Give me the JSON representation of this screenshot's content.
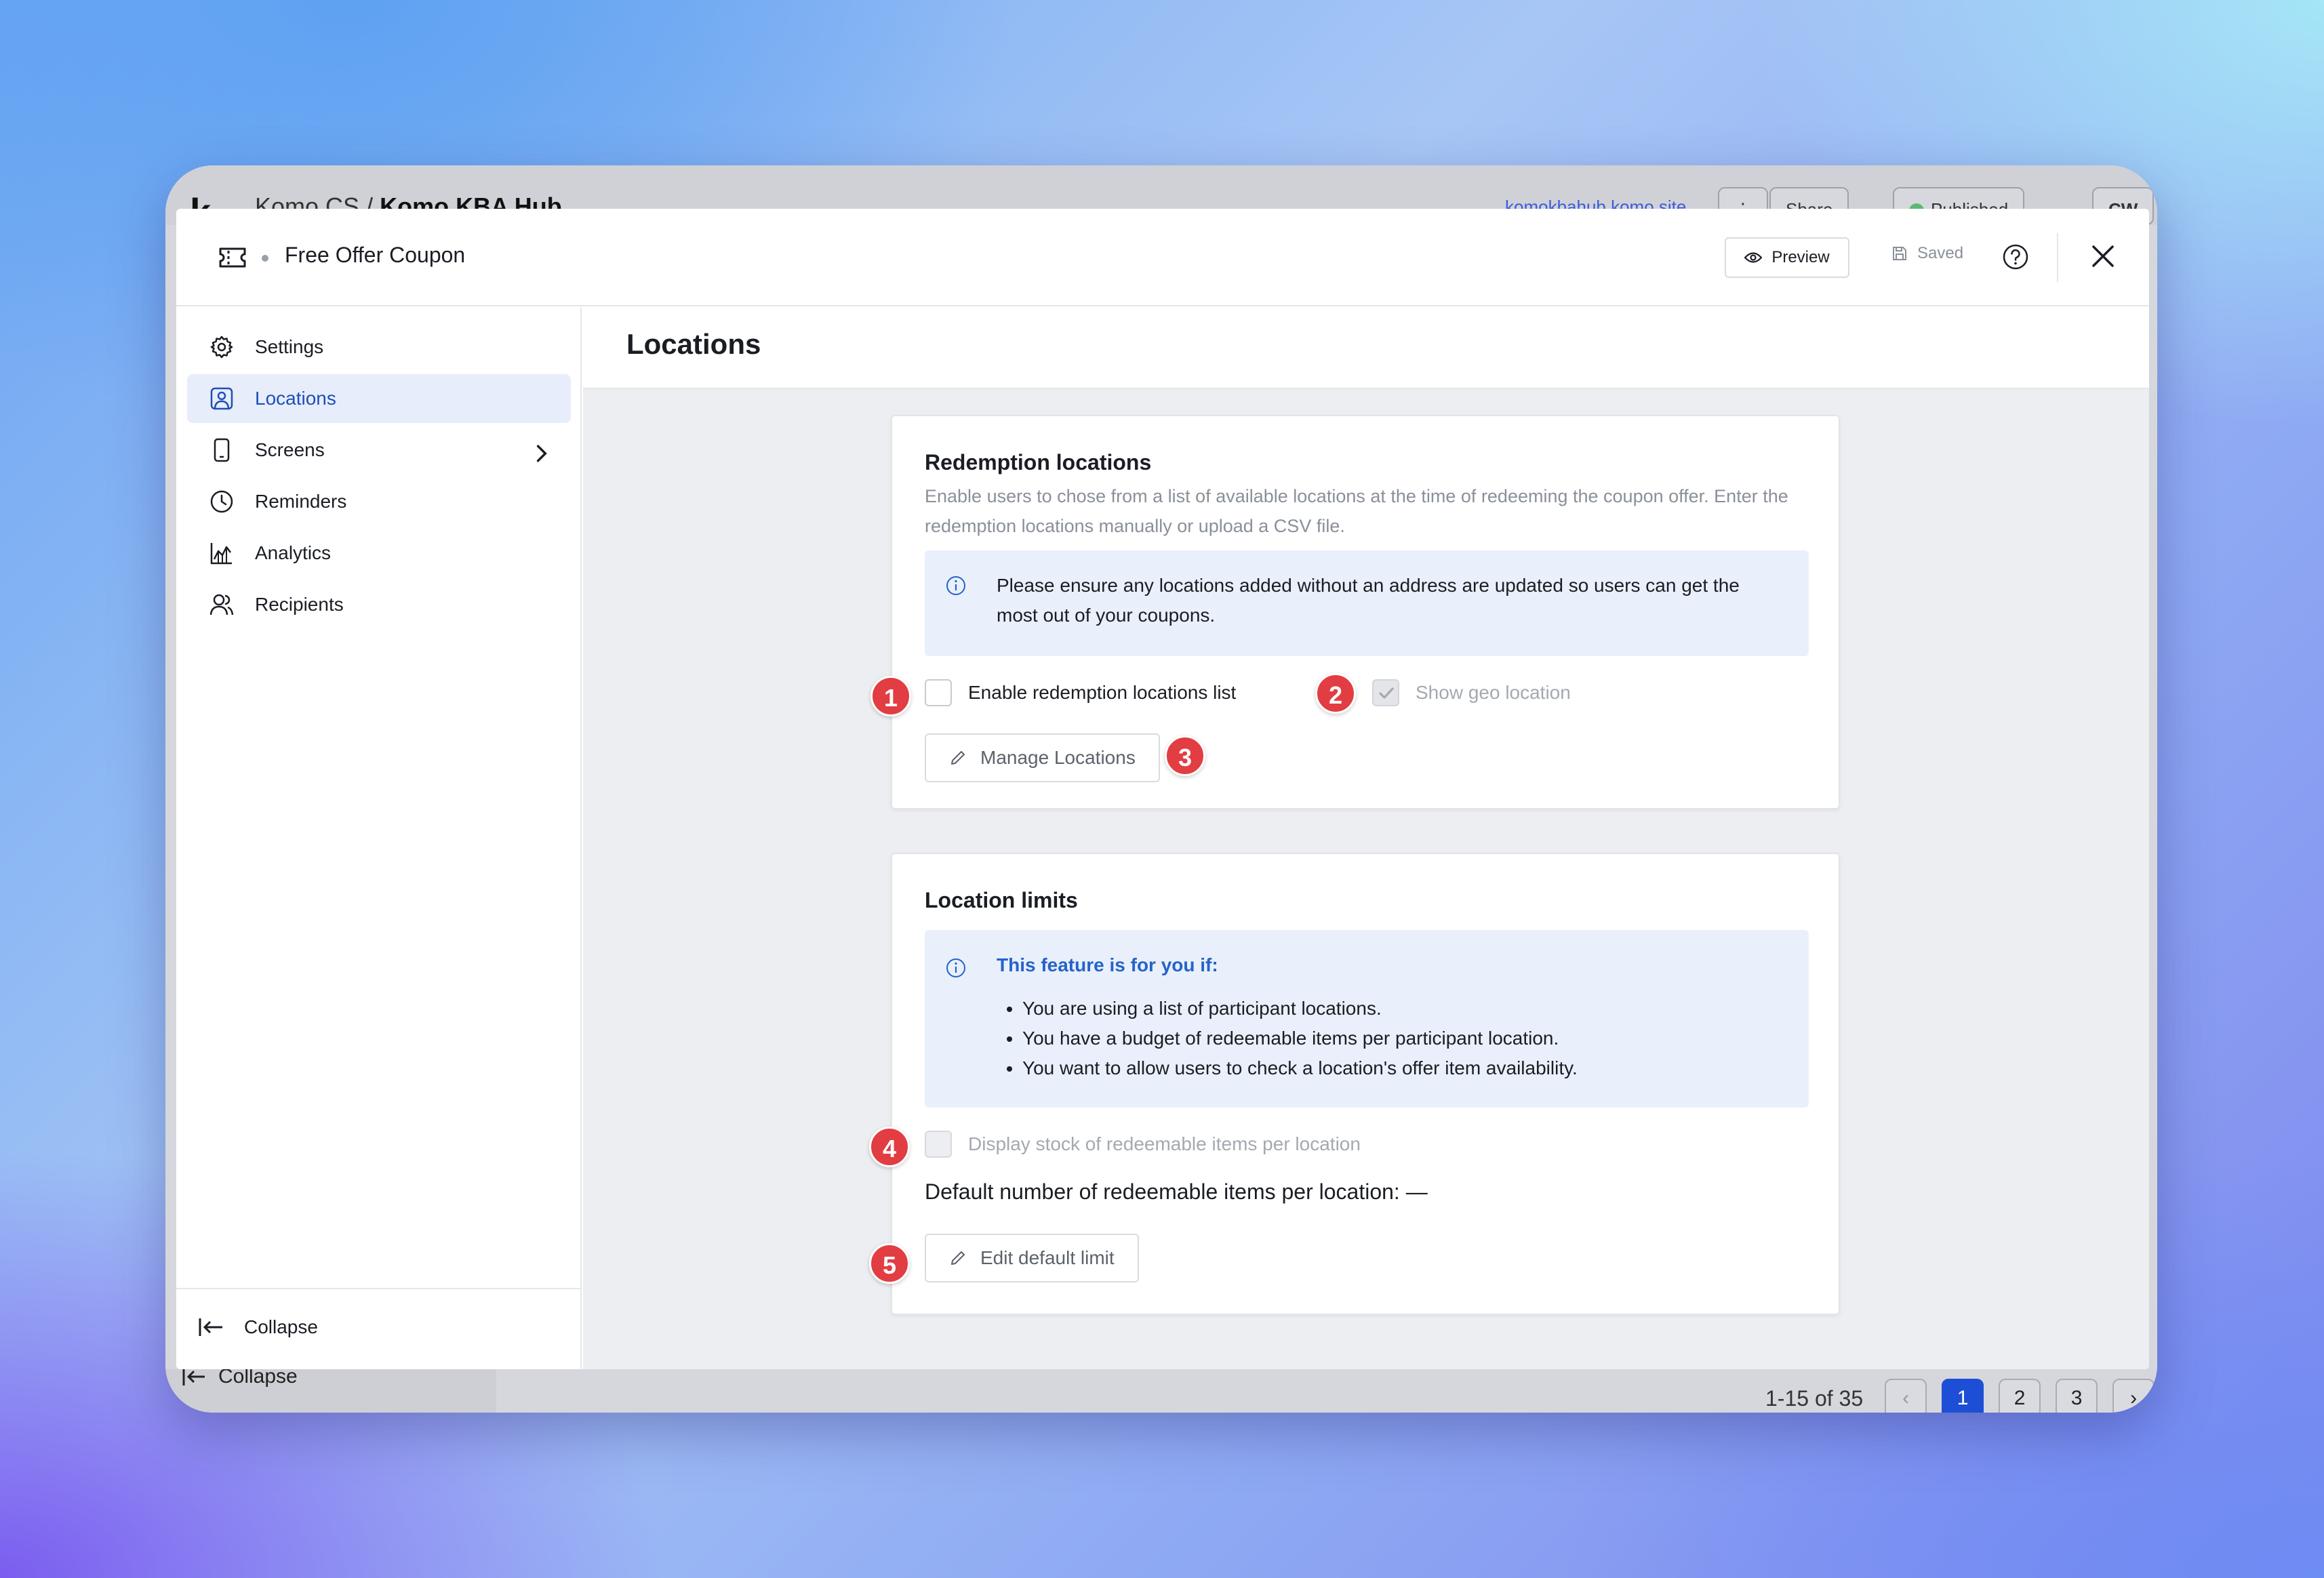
{
  "background_app": {
    "org": "Komo CS",
    "hub": "Komo KBA Hub",
    "site_link": "komokbahub.komo.site",
    "share_label": "Share",
    "status_label": "Published",
    "avatar": "CW",
    "collapse_label": "Collapse",
    "pagination": {
      "summary": "1-15 of 35",
      "pages": [
        "1",
        "2",
        "3"
      ],
      "current": "1"
    }
  },
  "modal": {
    "title": "Free Offer Coupon",
    "preview_label": "Preview",
    "saved_label": "Saved"
  },
  "sidebar": {
    "items": [
      {
        "label": "Settings",
        "icon": "gear-icon"
      },
      {
        "label": "Locations",
        "icon": "location-pin-icon",
        "active": true
      },
      {
        "label": "Screens",
        "icon": "phone-icon",
        "has_submenu": true
      },
      {
        "label": "Reminders",
        "icon": "clock-icon"
      },
      {
        "label": "Analytics",
        "icon": "chart-icon"
      },
      {
        "label": "Recipients",
        "icon": "users-icon"
      }
    ],
    "collapse_label": "Collapse"
  },
  "main": {
    "title": "Locations",
    "redemption": {
      "heading": "Redemption locations",
      "description": "Enable users to chose from a list of available locations at the time of redeeming the coupon offer. Enter the redemption locations manually or upload a CSV file.",
      "alert": "Please ensure any locations added without an address are updated so users can get the most out of your coupons.",
      "enable_list_label": "Enable redemption locations list",
      "enable_list_checked": false,
      "geo_label": "Show geo location",
      "geo_checked": true,
      "manage_button": "Manage Locations"
    },
    "limits": {
      "heading": "Location limits",
      "alert_title": "This feature is for you if:",
      "alert_items": [
        "You are using a list of participant locations.",
        "You have a budget of redeemable items per participant location.",
        "You want to allow users to check a location's offer item availability."
      ],
      "stock_label": "Display stock of redeemable items per location",
      "stock_checked": false,
      "default_text": "Default number of redeemable items per location: —",
      "edit_button": "Edit default limit"
    }
  },
  "annotations": [
    "1",
    "2",
    "3",
    "4",
    "5"
  ],
  "colors": {
    "accent": "#1d4fb8",
    "active_nav_bg": "#e8edfb",
    "alert_bg": "#e9f0fb",
    "badge": "#e23d42"
  }
}
